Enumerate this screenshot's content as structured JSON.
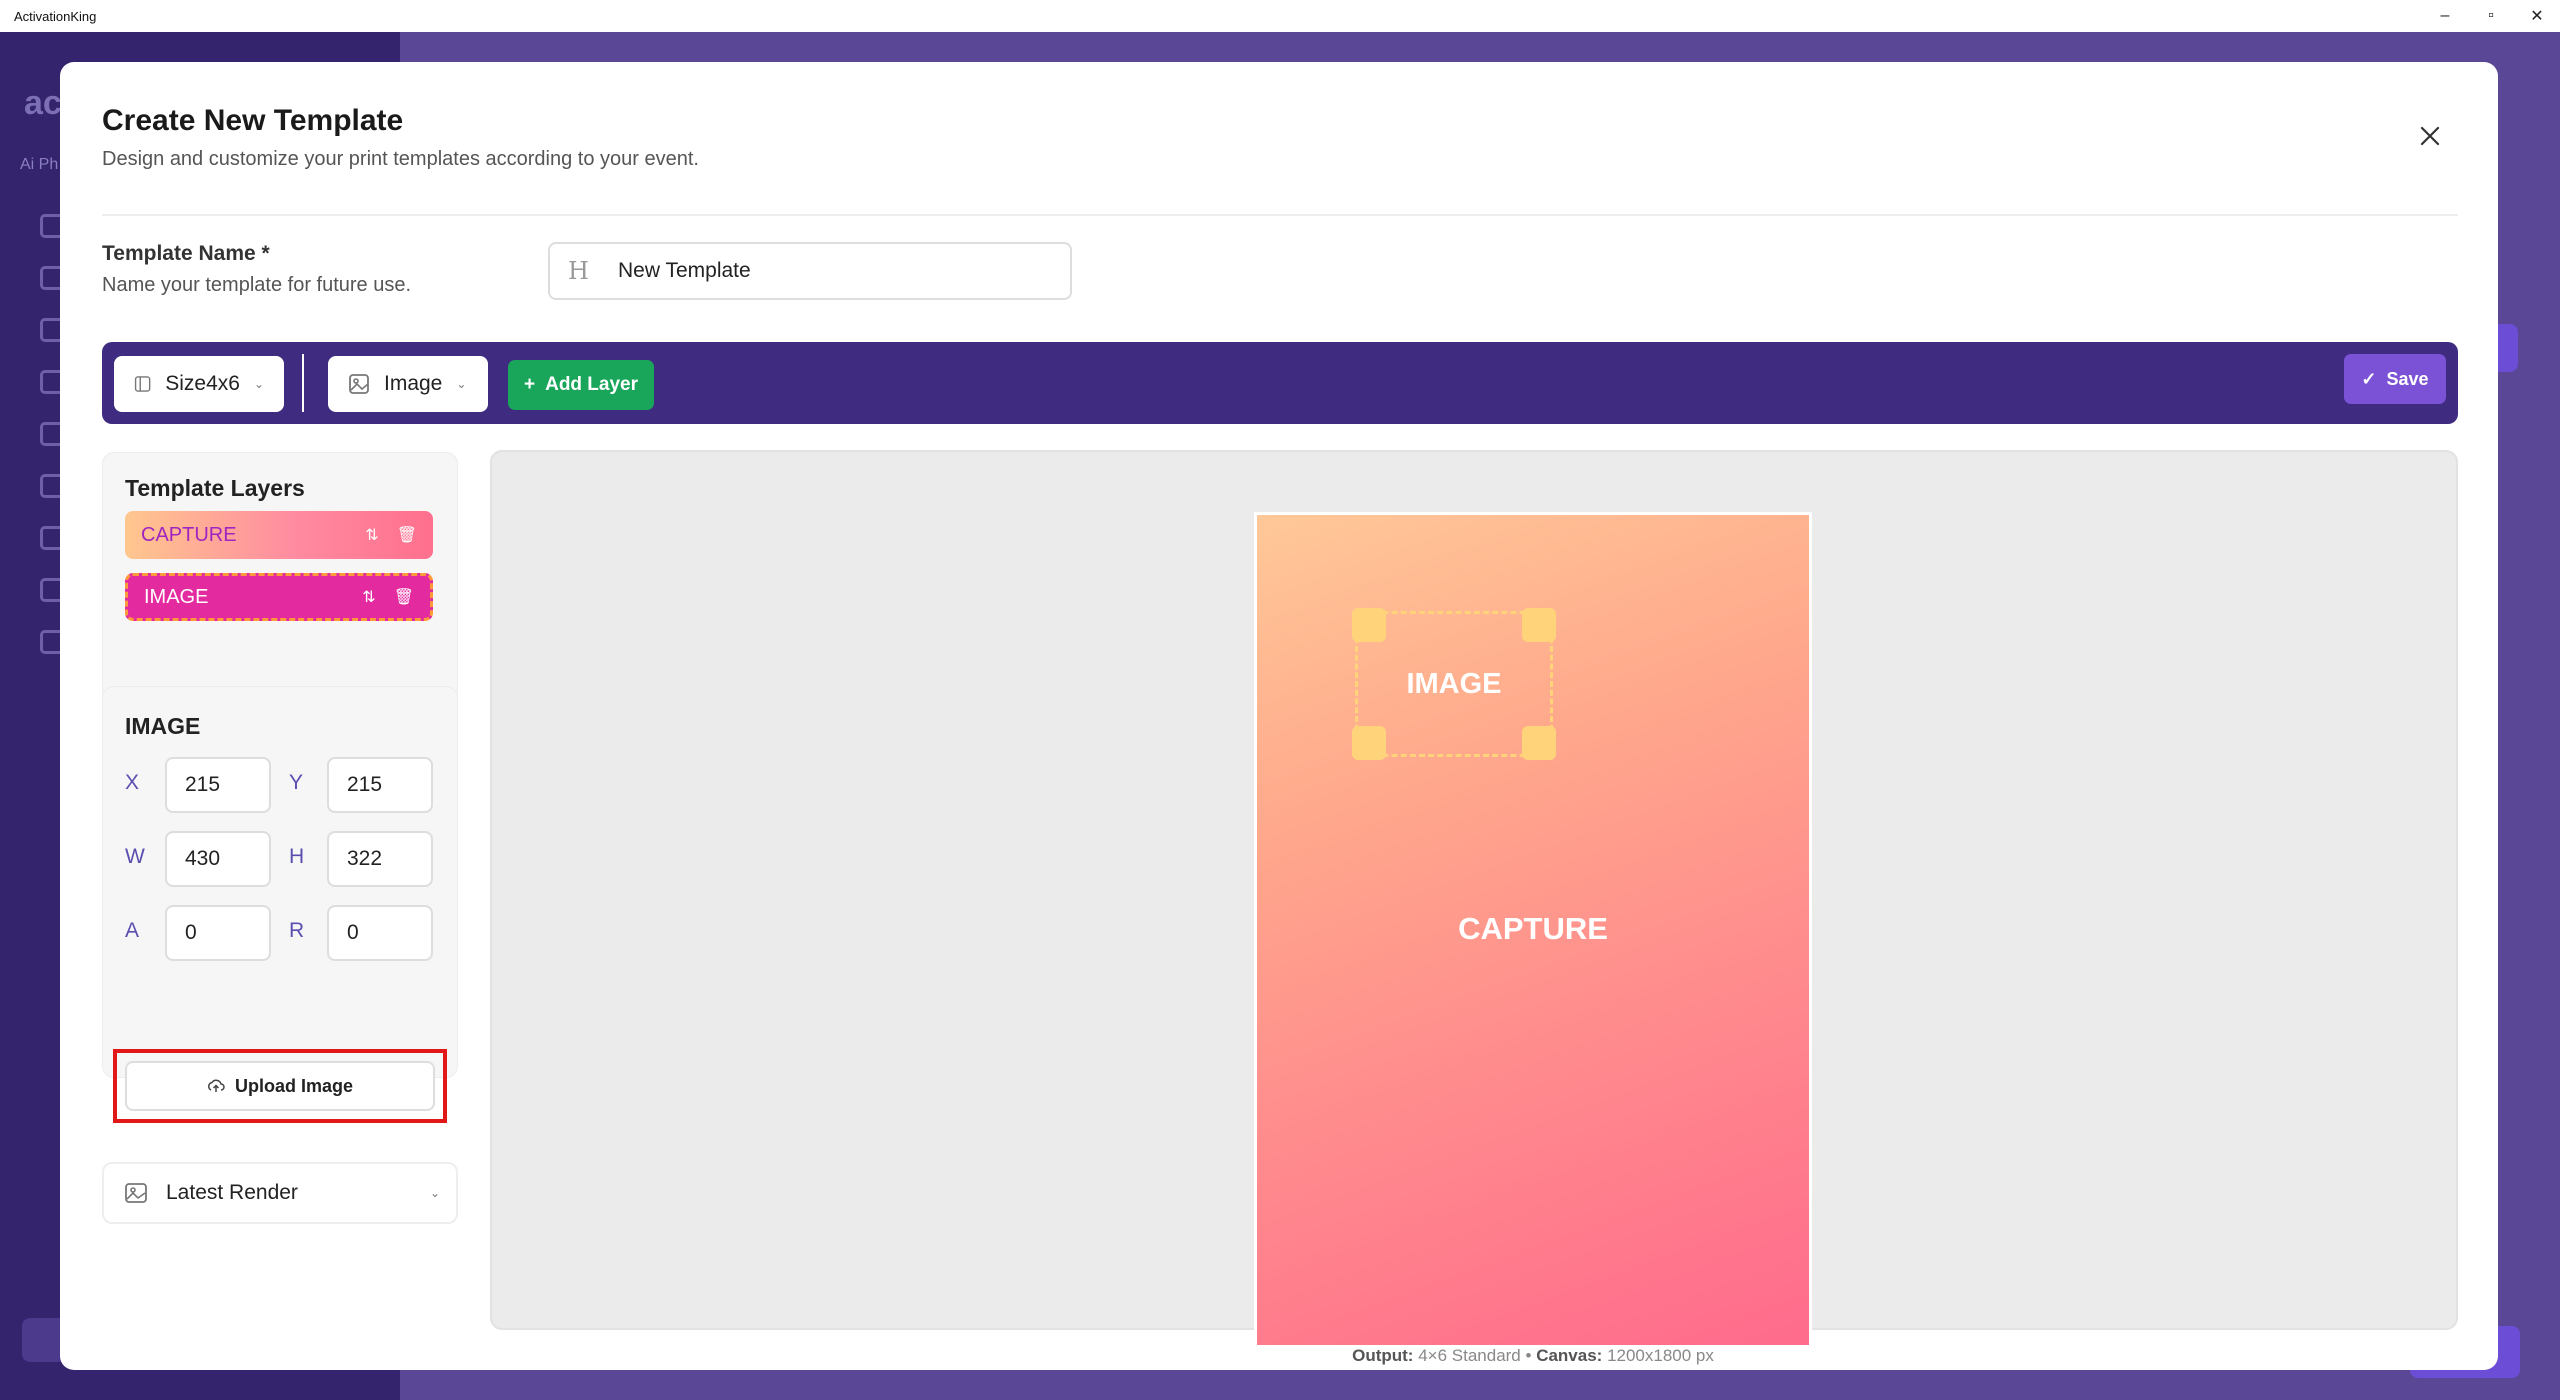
{
  "window": {
    "title": "ActivationKing",
    "controls": [
      "–",
      "▫",
      "✕"
    ]
  },
  "background_app": {
    "logo": "ac",
    "subtitle": "Ai Ph"
  },
  "modal": {
    "title": "Create New Template",
    "subtitle": "Design and customize your print templates according to your event."
  },
  "template_name": {
    "label": "Template Name *",
    "help": "Name your template for future use.",
    "value": "New Template",
    "icon": "heading-icon"
  },
  "toolbar": {
    "size_select": "Size4x6",
    "layer_type_select": "Image",
    "add_layer": "Add Layer",
    "save": "Save"
  },
  "layers": {
    "title": "Template Layers",
    "items": [
      {
        "label": "CAPTURE"
      },
      {
        "label": "IMAGE"
      }
    ]
  },
  "properties": {
    "title": "IMAGE",
    "fields": {
      "x": {
        "label": "X",
        "value": "215"
      },
      "y": {
        "label": "Y",
        "value": "215"
      },
      "w": {
        "label": "W",
        "value": "430"
      },
      "h": {
        "label": "H",
        "value": "322"
      },
      "a": {
        "label": "A",
        "value": "0"
      },
      "r": {
        "label": "R",
        "value": "0"
      }
    },
    "upload_button": "Upload Image"
  },
  "latest_render": {
    "label": "Latest Render"
  },
  "canvas": {
    "image_layer_label": "IMAGE",
    "capture_layer_label": "CAPTURE",
    "output_label": "Output:",
    "output_value": "4×6 Standard",
    "canvas_label": "Canvas:",
    "canvas_value": "1200x1800 px",
    "gradient": [
      "#ffc898",
      "#ff6b8c"
    ]
  },
  "colors": {
    "toolbar": "#3f2c80",
    "add_layer": "#19a65a",
    "save": "#7b52d6",
    "image_layer": "#e42a9f",
    "highlight": "#e01818"
  }
}
